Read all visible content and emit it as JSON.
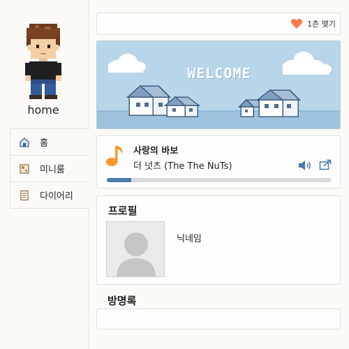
{
  "sidebar": {
    "home_label": "home",
    "nav": [
      {
        "label": "홈",
        "icon": "house-icon"
      },
      {
        "label": "미니룸",
        "icon": "miniroom-icon"
      },
      {
        "label": "다이어리",
        "icon": "diary-icon"
      }
    ]
  },
  "topbar": {
    "likes_label": "1촌 맺기",
    "heart_color": "#ff7a4d"
  },
  "banner": {
    "text": "WELCOME",
    "sky_color": "#b8d6ea"
  },
  "music": {
    "title": "사랑의 바보",
    "artist": "더 넛츠 (The The NuTs)",
    "progress": 0.11,
    "accent_color": "#4a79ad"
  },
  "profile": {
    "section_title": "프로필",
    "nickname": "닉네임"
  },
  "guestbook": {
    "section_title": "방명록"
  }
}
